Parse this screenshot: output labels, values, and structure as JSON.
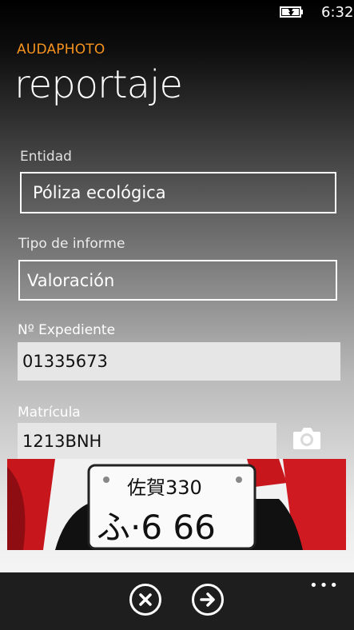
{
  "status": {
    "time": "6:32"
  },
  "app": {
    "name": "AUDAPHOTO",
    "page_title": "reportaje"
  },
  "form": {
    "entidad_label": "Entidad",
    "entidad_value": "Póliza ecológica",
    "tipo_label": "Tipo de informe",
    "tipo_value": "Valoración",
    "expediente_label": "Nº Expediente",
    "expediente_value": "01335673",
    "matricula_label": "Matrícula",
    "matricula_value": "1213BNH"
  },
  "photo": {
    "plate_top": "佐賀330",
    "plate_bottom": "ふ·6 66"
  },
  "appbar": {
    "ellipsis": "•••",
    "cancel_icon": "close-circle-icon",
    "next_icon": "arrow-right-circle-icon"
  },
  "colors": {
    "accent": "#f7931e",
    "field_bg": "#e6e6e6",
    "appbar_bg": "#1e1e1e"
  }
}
